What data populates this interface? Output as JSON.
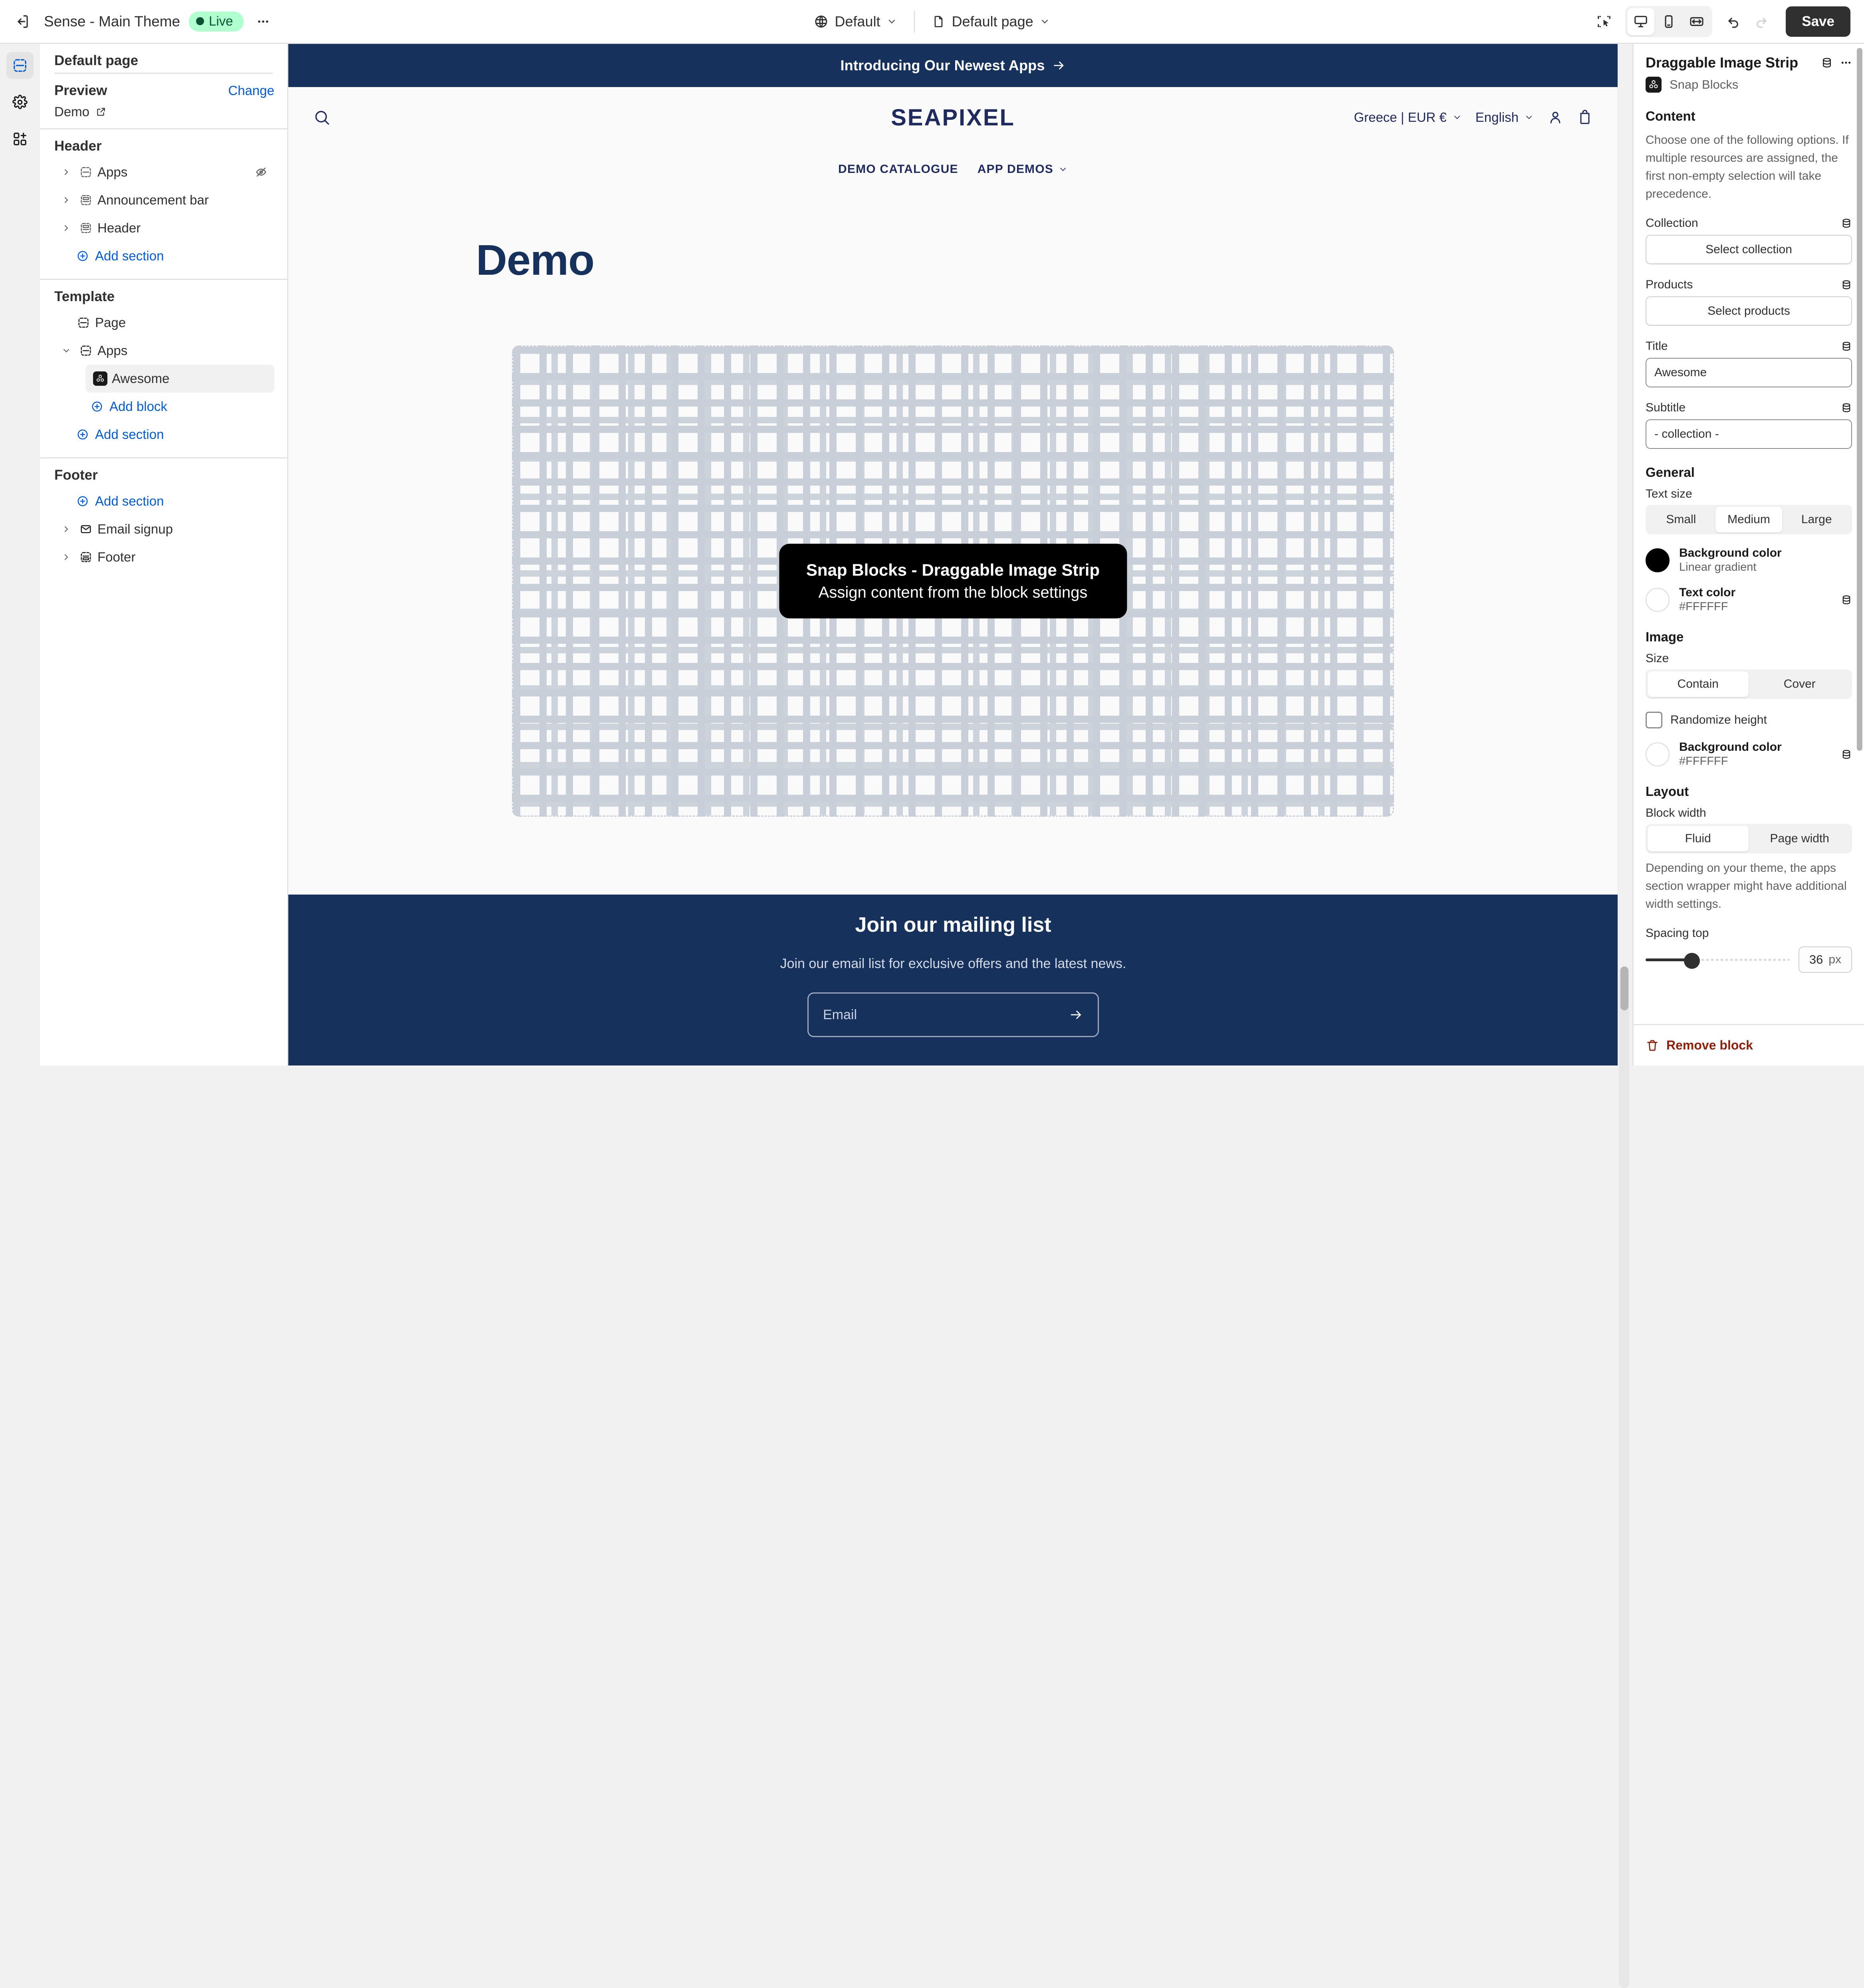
{
  "topbar": {
    "exit_icon": "exit-icon",
    "theme_name": "Sense - Main Theme",
    "status_badge": "Live",
    "more_icon": "ellipsis-icon",
    "market_selector": {
      "icon": "globe-icon",
      "label": "Default",
      "chevron": "chevron-down-icon"
    },
    "page_selector": {
      "icon": "page-icon",
      "label": "Default page",
      "chevron": "chevron-down-icon"
    },
    "inspector_icon": "select-pointer-icon",
    "devices": [
      {
        "name": "desktop-icon",
        "active": true
      },
      {
        "name": "mobile-icon",
        "active": false
      },
      {
        "name": "fullwidth-icon",
        "active": false
      }
    ],
    "undo_icon": "undo-icon",
    "redo_icon": "redo-icon",
    "save_label": "Save"
  },
  "rail": {
    "items": [
      {
        "name": "sections-icon",
        "active": true
      },
      {
        "name": "gear-icon",
        "active": false
      },
      {
        "name": "apps-add-icon",
        "active": false
      }
    ]
  },
  "left_panel": {
    "page_title": "Default page",
    "preview": {
      "label": "Preview",
      "change_label": "Change",
      "value": "Demo",
      "external_icon": "external-link-icon"
    },
    "groups": [
      {
        "title": "Header",
        "items": [
          {
            "label": "Apps",
            "icon": "section-icon",
            "caret": "chevron-right-icon",
            "trailing": "hidden-eye-icon",
            "indent": 0
          },
          {
            "label": "Announcement bar",
            "icon": "section-bar-icon",
            "caret": "chevron-right-icon",
            "trailing": "",
            "indent": 0
          },
          {
            "label": "Header",
            "icon": "section-bar-icon",
            "caret": "chevron-right-icon",
            "trailing": "",
            "indent": 0
          }
        ],
        "add_label": "Add section"
      },
      {
        "title": "Template",
        "items": [
          {
            "label": "Page",
            "icon": "section-icon",
            "caret": "",
            "trailing": "",
            "indent": 0
          },
          {
            "label": "Apps",
            "icon": "section-icon",
            "caret": "chevron-down-icon",
            "trailing": "",
            "indent": 0
          },
          {
            "label": "Awesome",
            "icon": "snap-blocks-icon",
            "caret": "",
            "trailing": "",
            "indent": 1,
            "selected": true
          }
        ],
        "add_block_label": "Add block",
        "add_label": "Add section"
      },
      {
        "title": "Footer",
        "add_label": "Add section",
        "items": [
          {
            "label": "Email signup",
            "icon": "envelope-icon",
            "caret": "chevron-right-icon",
            "trailing": "",
            "indent": 0
          },
          {
            "label": "Footer",
            "icon": "section-footer-icon",
            "caret": "chevron-right-icon",
            "trailing": "",
            "indent": 0
          }
        ]
      }
    ]
  },
  "canvas": {
    "announcement": {
      "text": "Introducing Our Newest Apps",
      "arrow": "arrow-right-icon"
    },
    "store_header": {
      "search_icon": "search-icon",
      "logo": "SEAPIXEL",
      "country_currency": "Greece | EUR €",
      "language": "English",
      "account_icon": "account-icon",
      "cart_icon": "cart-icon",
      "nav": [
        {
          "label": "DEMO CATALOGUE",
          "chevron": false
        },
        {
          "label": "APP DEMOS",
          "chevron": true
        }
      ]
    },
    "page_heading": "Demo",
    "block_placeholder": {
      "title": "Snap Blocks - Draggable Image Strip",
      "subtitle": "Assign content from the block settings"
    },
    "footer": {
      "title": "Join our mailing list",
      "subtitle": "Join our email list for exclusive offers and the latest news.",
      "email_placeholder": "Email",
      "submit_icon": "arrow-right-icon"
    }
  },
  "right_panel": {
    "title": "Draggable Image Strip",
    "db_icon": "database-icon",
    "more_icon": "ellipsis-icon",
    "app_name": "Snap Blocks",
    "app_icon": "snap-blocks-icon",
    "content": {
      "heading": "Content",
      "description": "Choose one of the following options. If multiple resources are assigned, the first non-empty selection will take precedence.",
      "collection_label": "Collection",
      "collection_button": "Select collection",
      "products_label": "Products",
      "products_button": "Select products",
      "title_label": "Title",
      "title_value": "Awesome",
      "subtitle_label": "Subtitle",
      "subtitle_value": "- collection -"
    },
    "general": {
      "heading": "General",
      "text_size_label": "Text size",
      "text_size_options": [
        "Small",
        "Medium",
        "Large"
      ],
      "text_size_selected": "Medium",
      "background_color_label": "Background color",
      "background_color_value": "Linear gradient",
      "background_color_swatch": "#000000",
      "text_color_label": "Text color",
      "text_color_value": "#FFFFFF",
      "text_color_swatch": "#FFFFFF"
    },
    "image": {
      "heading": "Image",
      "size_label": "Size",
      "size_options": [
        "Contain",
        "Cover"
      ],
      "size_selected": "Contain",
      "randomize_label": "Randomize height",
      "randomize_checked": false,
      "background_color_label": "Background color",
      "background_color_value": "#FFFFFF",
      "background_color_swatch": "#FFFFFF"
    },
    "layout": {
      "heading": "Layout",
      "block_width_label": "Block width",
      "block_width_options": [
        "Fluid",
        "Page width"
      ],
      "block_width_selected": "Fluid",
      "note": "Depending on your theme, the apps section wrapper might have additional width settings.",
      "spacing_top_label": "Spacing top",
      "spacing_top_value": "36",
      "spacing_top_unit": "px"
    },
    "remove_label": "Remove block",
    "remove_icon": "trash-icon"
  },
  "colors": {
    "brand_navy": "#16325C",
    "accent_blue": "#005BD3",
    "live_green_bg": "#AFFFCF",
    "live_green_fg": "#0C5132",
    "danger": "#8E1F0B"
  }
}
